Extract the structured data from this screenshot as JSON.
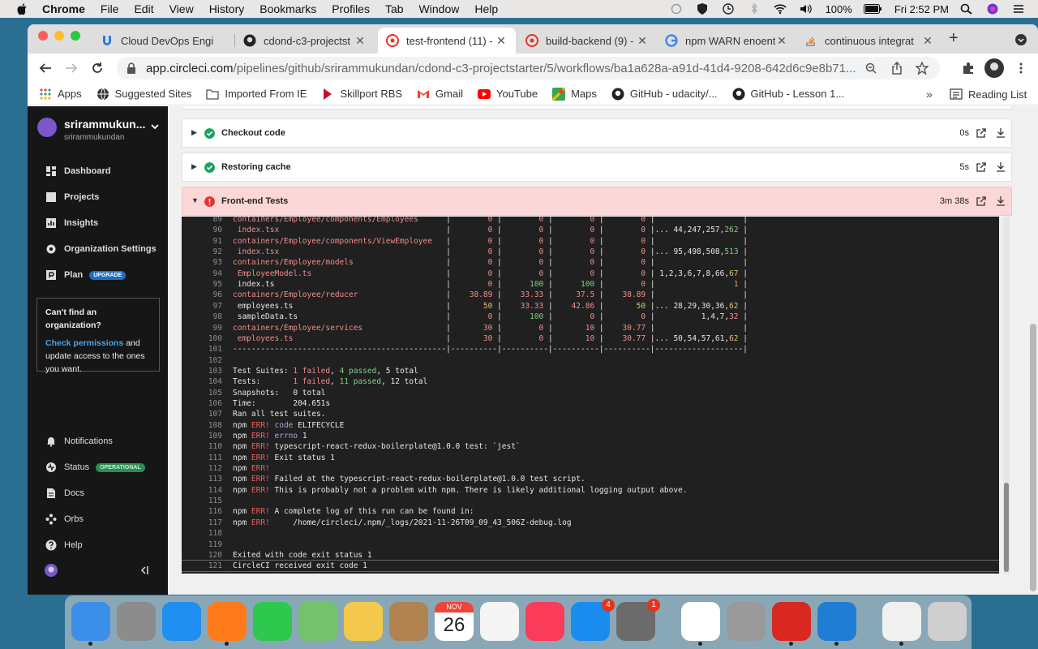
{
  "menubar": {
    "items": [
      "Chrome",
      "File",
      "Edit",
      "View",
      "History",
      "Bookmarks",
      "Profiles",
      "Tab",
      "Window",
      "Help"
    ],
    "battery": "100%",
    "clock": "Fri 2:52 PM"
  },
  "tabs": [
    {
      "label": "Cloud DevOps Engi",
      "icon": "udacity-icon"
    },
    {
      "label": "cdond-c3-projectst",
      "icon": "github-icon"
    },
    {
      "label": "test-frontend (11) -",
      "icon": "circleci-icon"
    },
    {
      "label": "build-backend (9) -",
      "icon": "circleci-icon"
    },
    {
      "label": "npm WARN enoent",
      "icon": "google-icon"
    },
    {
      "label": "continuous integrat",
      "icon": "stackoverflow-icon"
    }
  ],
  "omnibox": {
    "host": "app.circleci.com",
    "path": "/pipelines/github/srirammukundan/cdond-c3-projectstarter/5/workflows/ba1a628a-a91d-41d4-9208-642d6c9e8b71..."
  },
  "bookmarks": [
    "Apps",
    "Suggested Sites",
    "Imported From IE",
    "Skillport RBS",
    "Gmail",
    "YouTube",
    "Maps",
    "GitHub - udacity/...",
    "GitHub - Lesson 1...",
    "Reading List"
  ],
  "sidebar": {
    "org_name": "srirammukun...",
    "org_sub": "srirammukundan",
    "nav": [
      "Dashboard",
      "Projects",
      "Insights",
      "Organization Settings",
      "Plan"
    ],
    "plan_badge": "UPGRADE",
    "orgbox_title": "Can't find an organization?",
    "orgbox_link": "Check permissions",
    "orgbox_text": " and update access to the ones you want.",
    "bottom": [
      "Notifications",
      "Status",
      "Docs",
      "Orbs",
      "Help"
    ],
    "status_badge": "OPERATIONAL"
  },
  "steps": [
    {
      "label": "Checkout code",
      "duration": "0s",
      "status": "success"
    },
    {
      "label": "Restoring cache",
      "duration": "5s",
      "status": "success"
    },
    {
      "label": "Front-end Tests",
      "duration": "3m 38s",
      "status": "failed"
    }
  ],
  "terminal": [
    {
      "n": "89",
      "t": "containers/Employee/components/Employees      |        0 |        0 |        0 |        0 |                   |"
    },
    {
      "n": "90",
      "t": " index.tsx                                    |        0 |        0 |        0 |        0 |... 44,247,257,262 |"
    },
    {
      "n": "91",
      "t": "containers/Employee/components/ViewEmployee   |        0 |        0 |        0 |        0 |                   |"
    },
    {
      "n": "92",
      "t": " index.tsx                                    |        0 |        0 |        0 |        0 |... 95,498,508,513 |"
    },
    {
      "n": "93",
      "t": "containers/Employee/models                    |        0 |        0 |        0 |        0 |                   |"
    },
    {
      "n": "94",
      "t": " EmployeeModel.ts                             |        0 |        0 |        0 |        0 | 1,2,3,6,7,8,66,67 |"
    },
    {
      "n": "95",
      "t": " index.ts                                     |        0 |      100 |      100 |        0 |                 1 |"
    },
    {
      "n": "96",
      "t": "containers/Employee/reducer                   |    38.89 |    33.33 |     37.5 |    38.89 |                   |"
    },
    {
      "n": "97",
      "t": " employees.ts                                 |       50 |    33.33 |    42.86 |       50 |... 28,29,30,36,62 |"
    },
    {
      "n": "98",
      "t": " sampleData.ts                                |        0 |      100 |        0 |        0 |          1,4,7,32 |"
    },
    {
      "n": "99",
      "t": "containers/Employee/services                  |       30 |        0 |       10 |    30.77 |                   |"
    },
    {
      "n": "100",
      "t": " employees.ts                                 |       30 |        0 |       10 |    30.77 |... 50,54,57,61,62 |"
    },
    {
      "n": "101",
      "t": "----------------------------------------------|----------|----------|----------|----------|-------------------|"
    },
    {
      "n": "102",
      "t": ""
    },
    {
      "n": "103",
      "t": "Test Suites: 1 failed, 4 passed, 5 total"
    },
    {
      "n": "104",
      "t": "Tests:       1 failed, 11 passed, 12 total"
    },
    {
      "n": "105",
      "t": "Snapshots:   0 total"
    },
    {
      "n": "106",
      "t": "Time:        204.651s"
    },
    {
      "n": "107",
      "t": "Ran all test suites."
    },
    {
      "n": "108",
      "t": "npm ERR! code ELIFECYCLE"
    },
    {
      "n": "109",
      "t": "npm ERR! errno 1"
    },
    {
      "n": "110",
      "t": "npm ERR! typescript-react-redux-boilerplate@1.0.0 test: `jest`"
    },
    {
      "n": "111",
      "t": "npm ERR! Exit status 1"
    },
    {
      "n": "112",
      "t": "npm ERR!"
    },
    {
      "n": "113",
      "t": "npm ERR! Failed at the typescript-react-redux-boilerplate@1.0.0 test script."
    },
    {
      "n": "114",
      "t": "npm ERR! This is probably not a problem with npm. There is likely additional logging output above."
    },
    {
      "n": "115",
      "t": ""
    },
    {
      "n": "116",
      "t": "npm ERR! A complete log of this run can be found in:"
    },
    {
      "n": "117",
      "t": "npm ERR!     /home/circleci/.npm/_logs/2021-11-26T09_09_43_506Z-debug.log"
    },
    {
      "n": "118",
      "t": ""
    },
    {
      "n": "119",
      "t": ""
    },
    {
      "n": "120",
      "t": "Exited with code exit status 1"
    },
    {
      "n": "121",
      "t": "CircleCI received exit code 1"
    }
  ],
  "dock": [
    {
      "name": "finder-icon",
      "color": "#3b8fe8"
    },
    {
      "name": "launchpad-icon",
      "color": "#8c8c8c"
    },
    {
      "name": "safari-icon",
      "color": "#1f8ef1"
    },
    {
      "name": "firefox-icon",
      "color": "#ff7a1a"
    },
    {
      "name": "facetime-icon",
      "color": "#2fc84e"
    },
    {
      "name": "maps-icon",
      "color": "#74c36c"
    },
    {
      "name": "photos-icon",
      "color": "#f2c94c"
    },
    {
      "name": "contacts-icon",
      "color": "#b08350"
    },
    {
      "name": "calendar-icon",
      "color": "#ffffff",
      "month": "NOV",
      "day": "26"
    },
    {
      "name": "reminders-icon",
      "color": "#f5f5f5"
    },
    {
      "name": "music-icon",
      "color": "#fa3b5a"
    },
    {
      "name": "appstore-icon",
      "color": "#1a8cf0",
      "badge": "4"
    },
    {
      "name": "system-preferences-icon",
      "color": "#6b6b6b",
      "badge": "1"
    },
    {
      "name": "chrome-icon",
      "color": "#ffffff"
    },
    {
      "name": "calculator-icon",
      "color": "#9a9a9a"
    },
    {
      "name": "acrobat-icon",
      "color": "#d8281f"
    },
    {
      "name": "vscode-icon",
      "color": "#1f7ed3"
    },
    {
      "name": "script-editor-icon",
      "color": "#f0f0f0"
    },
    {
      "name": "trash-icon",
      "color": "#cfcfcf"
    }
  ]
}
